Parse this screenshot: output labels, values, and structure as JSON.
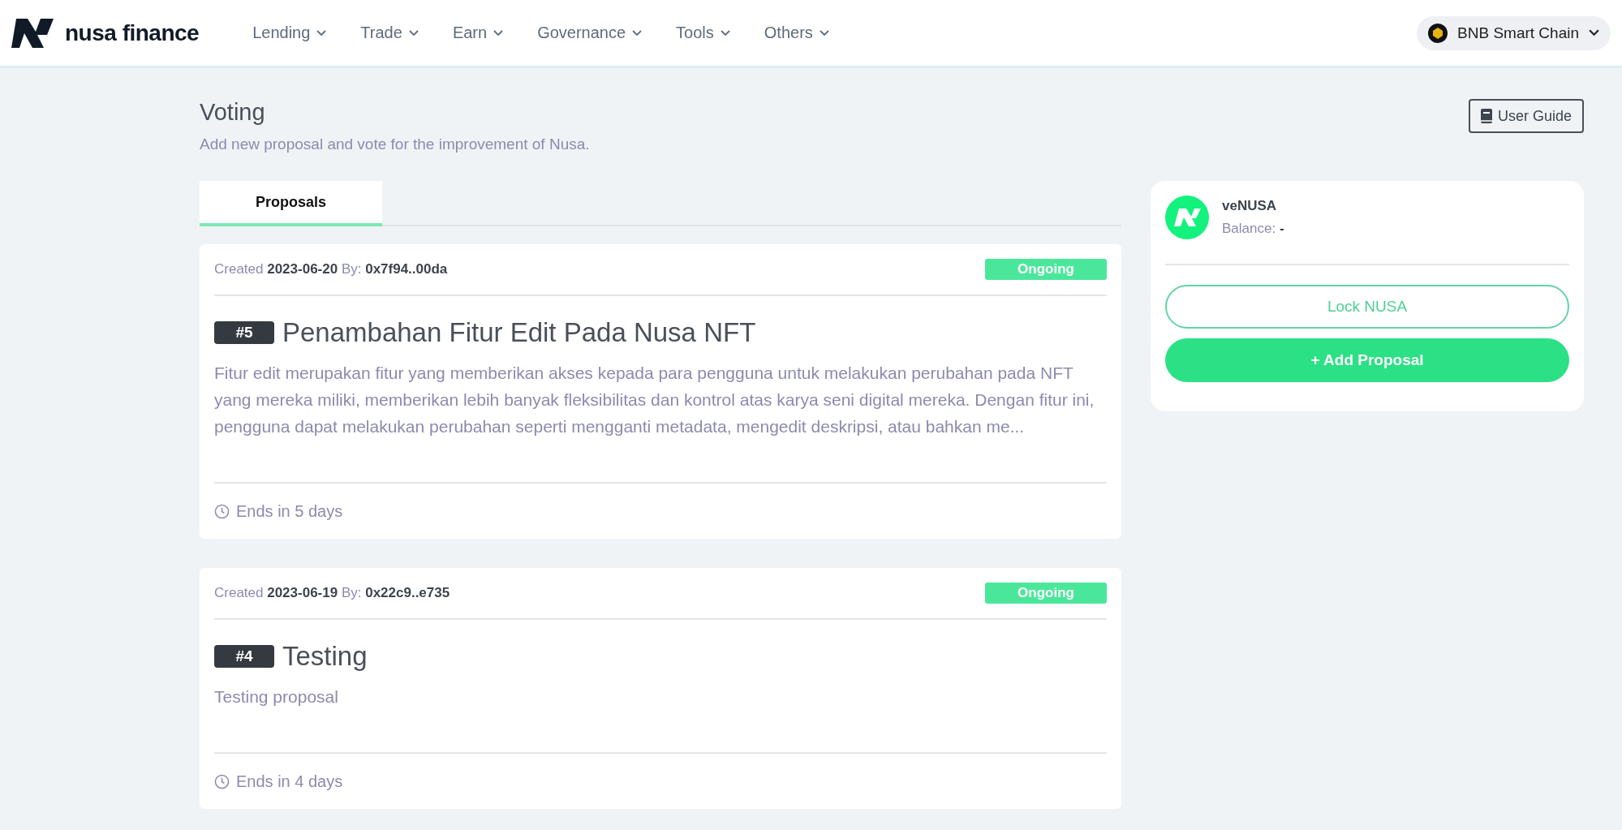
{
  "header": {
    "brand": "nusa finance",
    "nav": [
      {
        "label": "Lending"
      },
      {
        "label": "Trade"
      },
      {
        "label": "Earn"
      },
      {
        "label": "Governance"
      },
      {
        "label": "Tools"
      },
      {
        "label": "Others"
      }
    ],
    "network": "BNB Smart Chain"
  },
  "page": {
    "title": "Voting",
    "subtitle": "Add new proposal and vote for the improvement of Nusa.",
    "user_guide": "User Guide"
  },
  "tabs": [
    {
      "label": "Proposals",
      "selected": true
    }
  ],
  "proposals": [
    {
      "meta": "Created **2023-06-20** By: **0x7f94..00da**",
      "status": "Ongoing",
      "number": "#5",
      "title": "Penambahan Fitur Edit Pada Nusa NFT",
      "description": "Fitur edit merupakan fitur yang memberikan akses kepada para pengguna untuk melakukan perubahan pada NFT yang mereka miliki, memberikan lebih banyak fleksibilitas dan kontrol atas karya seni digital mereka. Dengan fitur ini, pengguna dapat melakukan perubahan seperti mengganti metadata, mengedit deskripsi, atau bahkan me...",
      "ends": "Ends in 5 days"
    },
    {
      "meta": "Created **2023-06-19** By: **0x22c9..e735**",
      "status": "Ongoing",
      "number": "#4",
      "title": "Testing",
      "description": "Testing proposal",
      "ends": "Ends in 4 days"
    }
  ],
  "sidebar": {
    "token": "veNUSA",
    "balance": "Balance: **-**",
    "lock_button": "Lock NUSA",
    "add_button": "+ Add Proposal"
  }
}
